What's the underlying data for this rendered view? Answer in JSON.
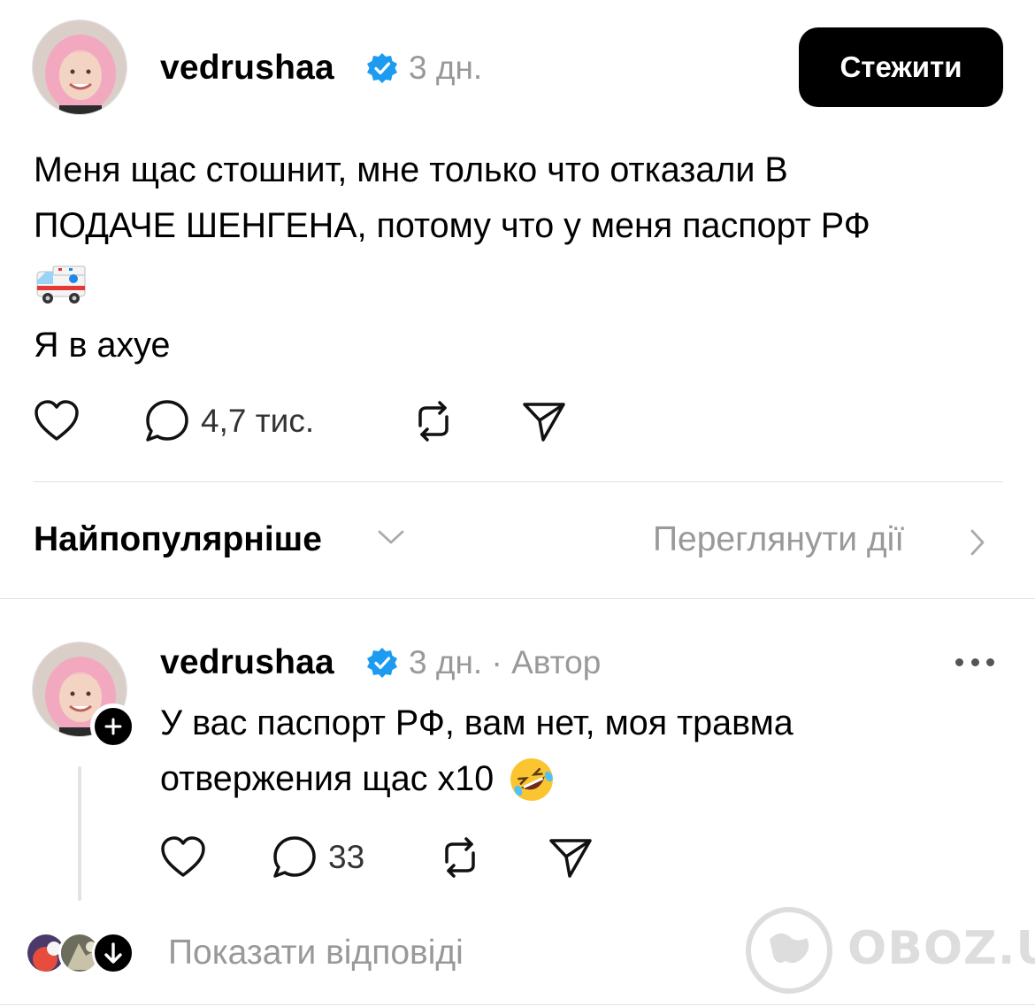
{
  "post": {
    "username": "vedrushaa",
    "verified_icon": "verified-badge-icon",
    "time": "3 дн.",
    "follow_label": "Стежити",
    "text_lines": [
      "Меня щас стошнит, мне только что отказали В",
      "ПОДАЧЕ ШЕНГЕНА, потому что у меня паспорт РФ"
    ],
    "emoji": "ambulance-emoji",
    "text_last": "Я в ахуе",
    "comment_count": "4,7 тис.",
    "icons": [
      "heart-icon",
      "comment-icon",
      "repost-icon",
      "share-icon"
    ]
  },
  "sort_bar": {
    "sort_label": "Найпопулярніше",
    "activity_label": "Переглянути дії"
  },
  "reply": {
    "username": "vedrushaa",
    "time": "3 дн.",
    "separator": "·",
    "author_tag": "Автор",
    "text_lines": [
      "У вас паспорт РФ, вам нет, моя травма",
      "отвержения щас x10"
    ],
    "emoji": "rolling-on-floor-laughing-emoji",
    "comment_count": "33"
  },
  "footer": {
    "show_replies_label": "Показати відповіді"
  },
  "watermark": {
    "text": "OBOZ.UA"
  },
  "colors": {
    "accent_blue": "#1d9bf0",
    "muted": "#999999",
    "divider": "#e2e2e2",
    "avatar_hair": "#f2a9c0"
  }
}
